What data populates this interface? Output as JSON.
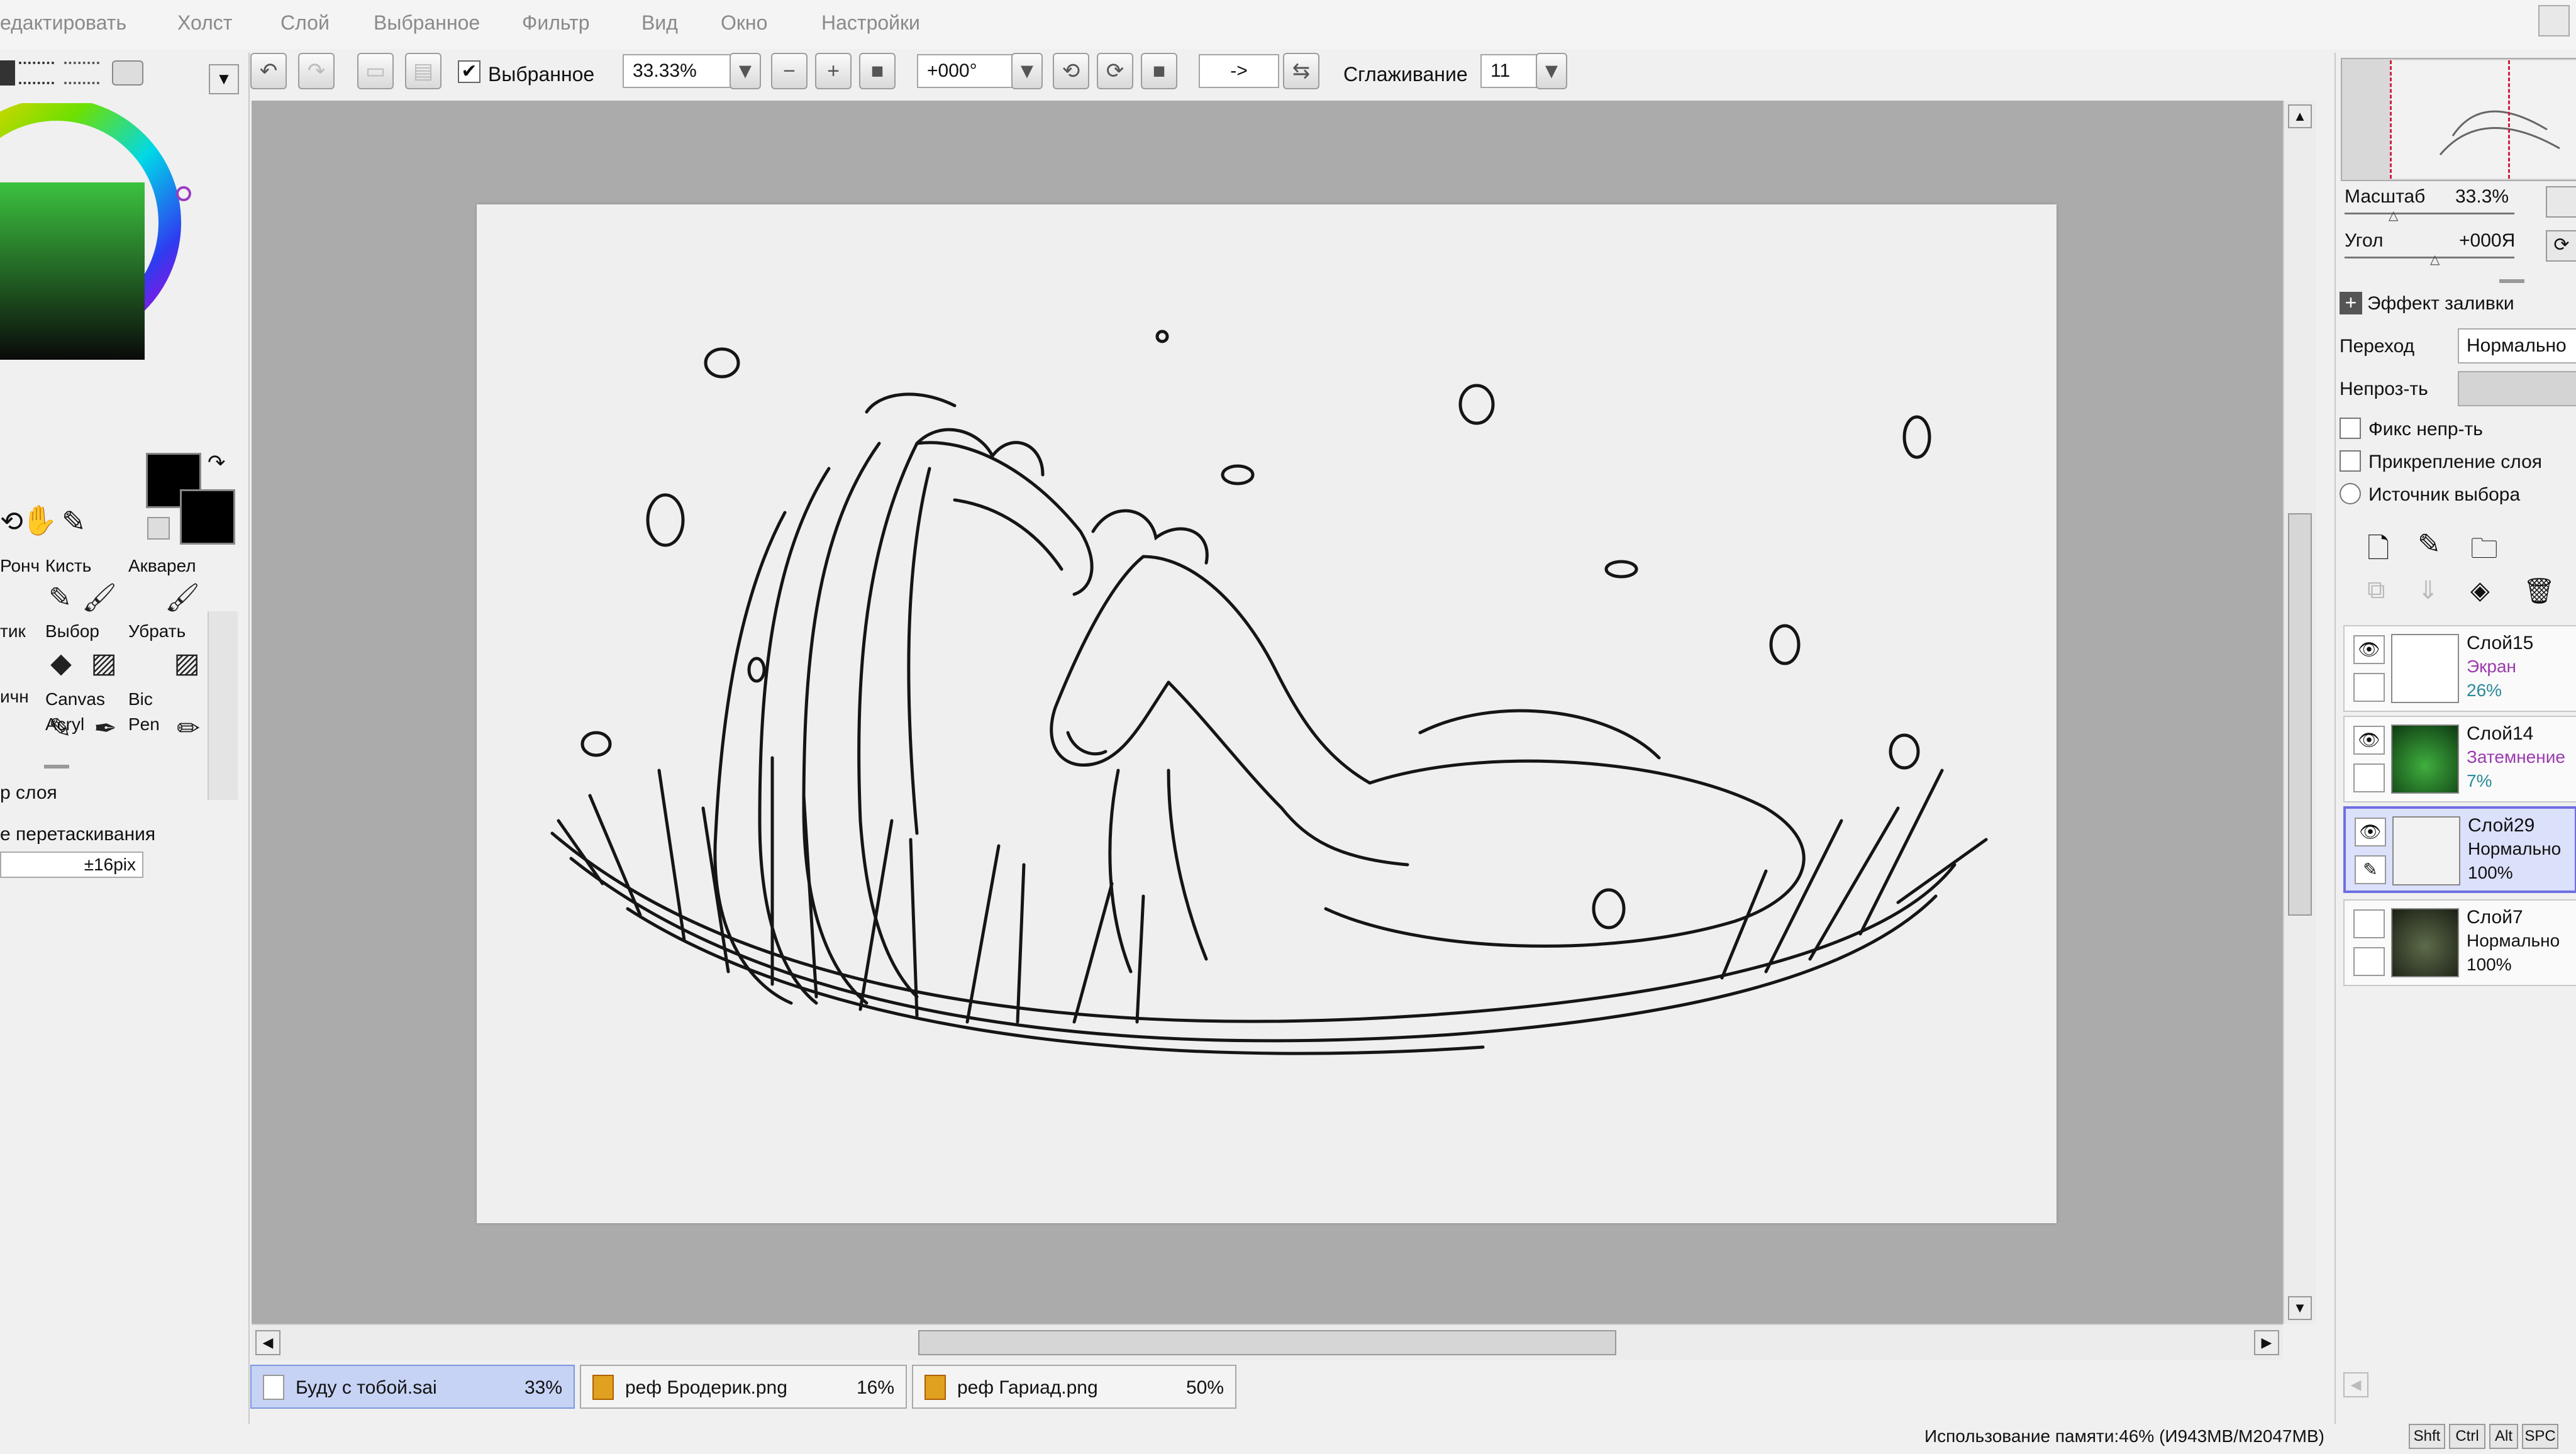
{
  "menu": [
    "едактировать",
    "Холст",
    "Слой",
    "Выбранное",
    "Фильтр",
    "Вид",
    "Окно",
    "Настройки"
  ],
  "toolbar": {
    "selection_checkbox_label": "Выбранное",
    "selection_checked": true,
    "zoom_value": "33.33%",
    "angle_value": "+000°",
    "arrow_button": "->",
    "smoothing_label": "Сглаживание",
    "smoothing_value": "11"
  },
  "colors": {
    "primary": "#000000",
    "secondary": "#000000",
    "accent_tab": "#c7d3f4",
    "selected_layer": "#dbe0fb",
    "canvas_bg": "#ababab",
    "paper": "#efefef"
  },
  "tools": [
    {
      "label": "Ронч",
      "icon": "pencil-icon"
    },
    {
      "label": "Кисть",
      "icon": "brush-icon"
    },
    {
      "label": "Акварел",
      "icon": "watercolor-icon"
    },
    {
      "label": "тик",
      "icon": "eraser-icon"
    },
    {
      "label": "Выбор",
      "icon": "select-pen-icon"
    },
    {
      "label": "Убрать",
      "icon": "deselect-pen-icon"
    },
    {
      "label": "ичн",
      "icon": "pencil-icon"
    },
    {
      "label": "Canvas Acryl",
      "icon": "brush-icon"
    },
    {
      "label": "Bic Pen",
      "icon": "pen-icon"
    }
  ],
  "tool_options": {
    "layer_source_label": "р слоя",
    "drag_label": "е перетаскивания",
    "drag_value": "±16pix"
  },
  "navigator": {
    "scale_label": "Масштаб",
    "scale_value": "33.3%",
    "angle_label": "Угол",
    "angle_value": "+000Я"
  },
  "layer_props": {
    "effect_label": "Эффект заливки",
    "blend_label": "Переход",
    "blend_value": "Нормально",
    "opacity_label": "Непроз-ть",
    "opacity_value": 1.0,
    "checkboxes": [
      {
        "label": "Фикс непр-ть"
      },
      {
        "label": "Прикрепление слоя"
      }
    ],
    "radio_label": "Источник выбора"
  },
  "layers": [
    {
      "name": "Слой15",
      "mode": "Экран",
      "opacity": "26%",
      "visible": true,
      "selected": false,
      "thumb": "#ffffff",
      "mode_color": "#9b3bb0",
      "op_color": "#2a8a9a"
    },
    {
      "name": "Слой14",
      "mode": "Затемнение",
      "opacity": "7%",
      "visible": true,
      "selected": false,
      "thumb": "#1f6b2a",
      "mode_color": "#9b3bb0",
      "op_color": "#2a8a9a"
    },
    {
      "name": "Слой29",
      "mode": "Нормально",
      "opacity": "100%",
      "visible": true,
      "selected": true,
      "thumb": "#f2f2f2",
      "mode_color": "#111111",
      "op_color": "#111111"
    },
    {
      "name": "Слой7",
      "mode": "Нормально",
      "opacity": "100%",
      "visible": false,
      "selected": false,
      "thumb": "#3f4a34",
      "mode_color": "#111111",
      "op_color": "#111111"
    }
  ],
  "tabs": [
    {
      "name": "Буду с тобой.sai",
      "pct": "33%",
      "active": true
    },
    {
      "name": "реф Бродерик.png",
      "pct": "16%",
      "active": false
    },
    {
      "name": "реф Гариад.png",
      "pct": "50%",
      "active": false
    }
  ],
  "status": {
    "memory": "Использование памяти:46% (И943MB/M2047MB)",
    "keys": [
      "Shft",
      "Ctrl",
      "Alt",
      "SPC"
    ]
  }
}
